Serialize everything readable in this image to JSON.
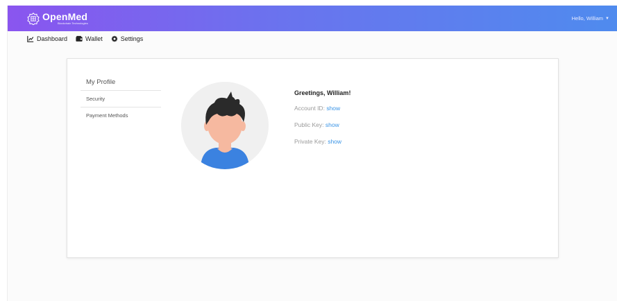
{
  "navbar": {
    "brand_name": "OpenMed",
    "brand_tagline": "Blockchain Technologies",
    "user_greeting": "Hello, William",
    "gradient_start": "#8a55ef",
    "gradient_end": "#4f8bee"
  },
  "subnav": [
    {
      "label": "Dashboard",
      "icon": "chart-line-icon"
    },
    {
      "label": "Wallet",
      "icon": "wallet-icon"
    },
    {
      "label": "Settings",
      "icon": "gear-icon"
    }
  ],
  "profile_menu": [
    {
      "label": "My Profile",
      "active": true
    },
    {
      "label": "Security",
      "active": false
    },
    {
      "label": "Payment Methods",
      "active": false
    }
  ],
  "profile": {
    "greeting": "Greetings, William!",
    "fields": [
      {
        "label": "Account ID:",
        "link": "show"
      },
      {
        "label": "Public Key:",
        "link": "show"
      },
      {
        "label": "Private Key:",
        "link": "show"
      }
    ]
  },
  "colors": {
    "link": "#3b95e6",
    "avatar_shirt": "#3b82e0",
    "avatar_skin": "#f6b9a0",
    "avatar_hair": "#2a2a2a"
  }
}
